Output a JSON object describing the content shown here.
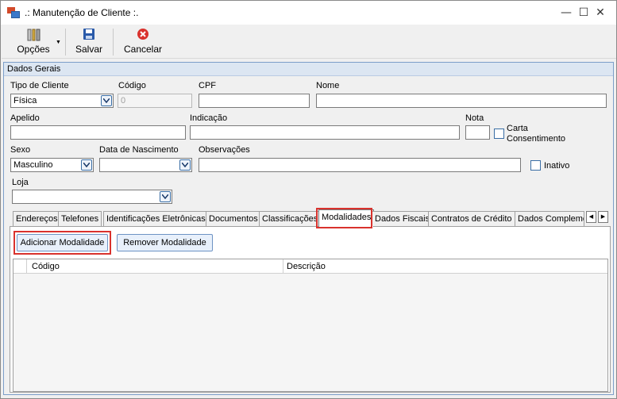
{
  "window": {
    "title": ".: Manutenção de Cliente :.",
    "minimize": "—",
    "maximize": "☐",
    "close": "✕"
  },
  "toolbar": {
    "opcoes_label": "Opções",
    "salvar_label": "Salvar",
    "cancelar_label": "Cancelar"
  },
  "group": {
    "title": "Dados Gerais"
  },
  "form": {
    "tipo_cliente": {
      "label": "Tipo de Cliente",
      "value": "Física"
    },
    "codigo": {
      "label": "Código",
      "value": "0"
    },
    "cpf": {
      "label": "CPF",
      "value": ""
    },
    "nome": {
      "label": "Nome",
      "value": ""
    },
    "apelido": {
      "label": "Apelido",
      "value": ""
    },
    "indicacao": {
      "label": "Indicação",
      "value": ""
    },
    "nota": {
      "label": "Nota",
      "value": ""
    },
    "carta_consentimento": {
      "label_line1": "Carta",
      "label_line2": "Consentimento",
      "checked": false
    },
    "sexo": {
      "label": "Sexo",
      "value": "Masculino"
    },
    "data_nascimento": {
      "label": "Data de Nascimento",
      "value": ""
    },
    "observacoes": {
      "label": "Observações",
      "value": ""
    },
    "inativo": {
      "label": "Inativo",
      "checked": false
    },
    "loja": {
      "label": "Loja",
      "value": ""
    }
  },
  "tabs": [
    {
      "label": "Endereços"
    },
    {
      "label": "Telefones"
    },
    {
      "label": "Identificações Eletrônicas"
    },
    {
      "label": "Documentos"
    },
    {
      "label": "Classificações"
    },
    {
      "label": "Modalidades",
      "selected": true
    },
    {
      "label": "Dados Fiscais"
    },
    {
      "label": "Contratos de Crédito"
    },
    {
      "label": "Dados Compleme"
    }
  ],
  "tab_scroll": {
    "left": "◀",
    "right": "▶"
  },
  "modalidades": {
    "add_button": "Adicionar Modalidade",
    "remove_button": "Remover Modalidade",
    "columns": [
      "Código",
      "Descrição"
    ]
  },
  "colors": {
    "highlight": "#d9322d",
    "group_border": "#7b9ec9",
    "button_border": "#6d93c4",
    "cancel_icon": "#d9322d",
    "save_icon": "#2a5aa9"
  },
  "icons": {
    "opcoes": "tools-icon",
    "salvar": "floppy-disk-icon",
    "cancelar": "cancel-x-icon"
  }
}
